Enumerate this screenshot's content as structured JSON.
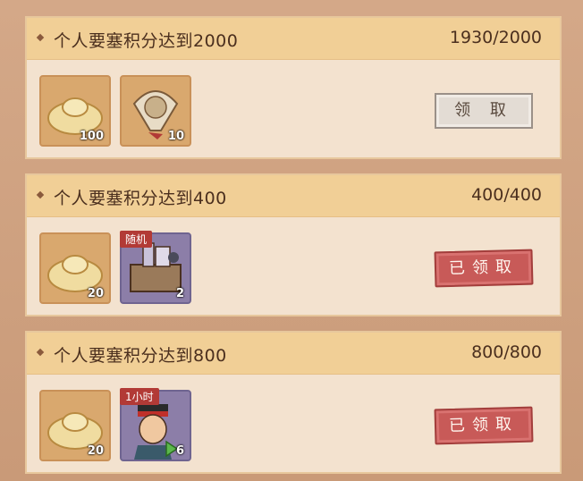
{
  "cards": [
    {
      "title": "个人要塞积分达到2000",
      "progress": "1930/2000",
      "button": "领 取",
      "button_state": "claimable",
      "items": [
        {
          "name": "gold-ingot",
          "qty": "100"
        },
        {
          "name": "fan",
          "qty": "10"
        }
      ]
    },
    {
      "title": "个人要塞积分达到400",
      "progress": "400/400",
      "button": "已领取",
      "button_state": "claimed",
      "items": [
        {
          "name": "gold-ingot",
          "qty": "20"
        },
        {
          "name": "random-chest",
          "qty": "2",
          "tag": "随机"
        }
      ]
    },
    {
      "title": "个人要塞积分达到800",
      "progress": "800/800",
      "button": "已领取",
      "button_state": "claimed",
      "items": [
        {
          "name": "gold-ingot",
          "qty": "20"
        },
        {
          "name": "speedup-portrait",
          "qty": "6",
          "tag": "1小时"
        }
      ]
    }
  ]
}
